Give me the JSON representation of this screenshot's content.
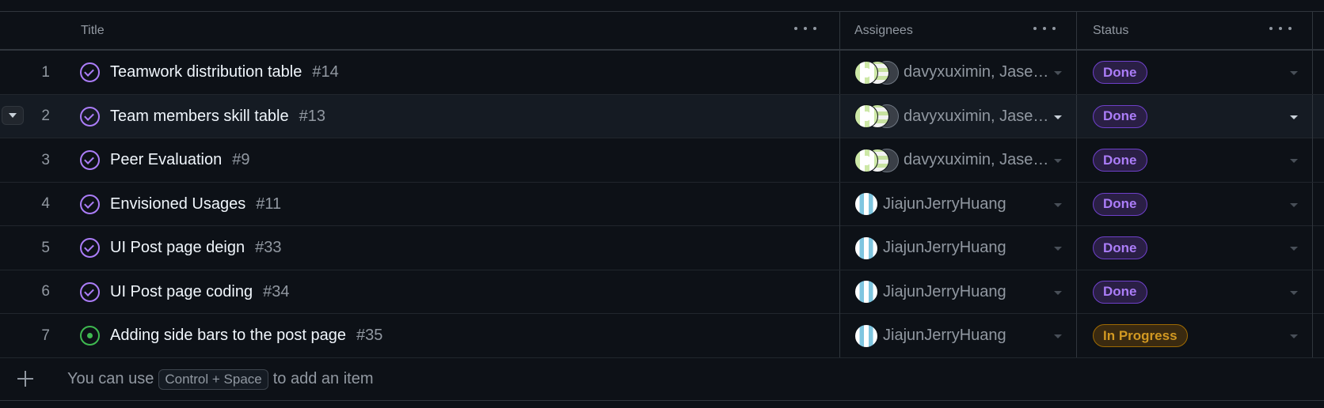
{
  "header": {
    "title": "Title",
    "assignees": "Assignees",
    "status": "Status"
  },
  "rows": [
    {
      "num": "1",
      "state": "done",
      "title": "Teamwork distribution table",
      "issue": "#14",
      "assignees": "davyxuximin, Jases...",
      "multi": true,
      "status": "Done"
    },
    {
      "num": "2",
      "state": "done",
      "title": "Team members skill table",
      "issue": "#13",
      "assignees": "davyxuximin, Jases...",
      "multi": true,
      "status": "Done"
    },
    {
      "num": "3",
      "state": "done",
      "title": "Peer Evaluation",
      "issue": "#9",
      "assignees": "davyxuximin, Jases...",
      "multi": true,
      "status": "Done"
    },
    {
      "num": "4",
      "state": "done",
      "title": "Envisioned Usages",
      "issue": "#11",
      "assignees": "JiajunJerryHuang",
      "multi": false,
      "status": "Done"
    },
    {
      "num": "5",
      "state": "done",
      "title": "UI Post page deign",
      "issue": "#33",
      "assignees": "JiajunJerryHuang",
      "multi": false,
      "status": "Done"
    },
    {
      "num": "6",
      "state": "done",
      "title": "UI Post page coding",
      "issue": "#34",
      "assignees": "JiajunJerryHuang",
      "multi": false,
      "status": "Done"
    },
    {
      "num": "7",
      "state": "open",
      "title": "Adding side bars to the post page",
      "issue": "#35",
      "assignees": "JiajunJerryHuang",
      "multi": false,
      "status": "In Progress"
    }
  ],
  "add_item": {
    "prefix": "You can use",
    "shortcut": "Control + Space",
    "suffix": "to add an item"
  },
  "colors": {
    "background": "#0d1117",
    "done_purple": "#ab7df8",
    "open_green": "#3fb950",
    "in_progress": "#d29922"
  }
}
